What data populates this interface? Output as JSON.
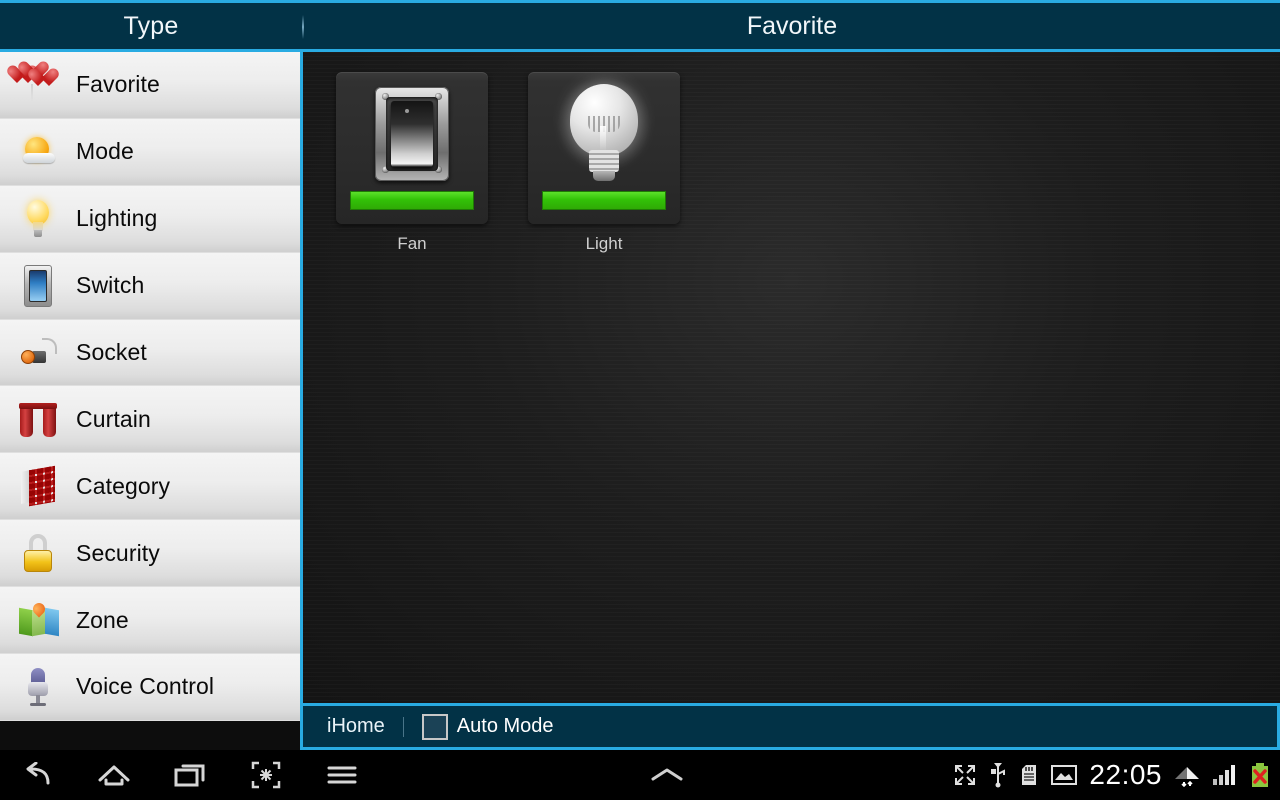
{
  "header": {
    "type_title": "Type",
    "section_title": "Favorite"
  },
  "sidebar": {
    "items": [
      {
        "label": "Favorite",
        "icon": "balloon-hearts-icon"
      },
      {
        "label": "Mode",
        "icon": "sun-cloud-icon"
      },
      {
        "label": "Lighting",
        "icon": "light-bulb-icon"
      },
      {
        "label": "Switch",
        "icon": "wall-switch-icon"
      },
      {
        "label": "Socket",
        "icon": "power-socket-icon"
      },
      {
        "label": "Curtain",
        "icon": "curtain-icon"
      },
      {
        "label": "Category",
        "icon": "category-grid-icon"
      },
      {
        "label": "Security",
        "icon": "padlock-icon"
      },
      {
        "label": "Zone",
        "icon": "map-pin-icon"
      },
      {
        "label": "Voice Control",
        "icon": "microphone-icon"
      }
    ]
  },
  "main": {
    "tiles": [
      {
        "label": "Fan",
        "icon": "rocker-switch-icon",
        "state_bar_color": "#35c207",
        "state": "on"
      },
      {
        "label": "Light",
        "icon": "light-bulb-icon",
        "state_bar_color": "#35c207",
        "state": "on"
      }
    ]
  },
  "appbar": {
    "brand": "iHome",
    "auto_mode_label": "Auto Mode",
    "auto_mode_checked": false
  },
  "navbar": {
    "back": "back-icon",
    "home": "home-icon",
    "recents": "recent-apps-icon",
    "screenshot": "screenshot-icon",
    "menu": "menu-icon",
    "expand": "chevron-up-icon",
    "status": {
      "fullscreen": "fullscreen-icon",
      "usb": "usb-icon",
      "sdcard": "sd-card-icon",
      "screenshot_saved": "image-icon",
      "time": "22:05",
      "wifi": "wifi-icon",
      "signal": "signal-bars-icon",
      "battery": "battery-error-icon"
    }
  },
  "colors": {
    "accent": "#29abe2",
    "header_bg": "#023246",
    "state_on": "#35c207"
  }
}
